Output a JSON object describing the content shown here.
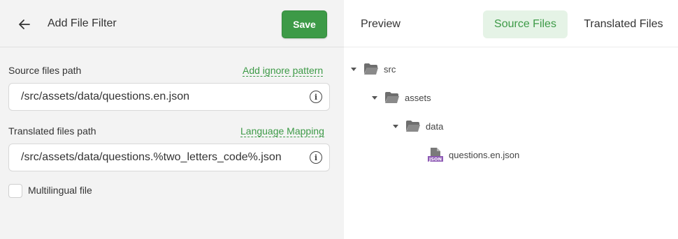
{
  "header": {
    "title": "Add File Filter",
    "save_label": "Save"
  },
  "form": {
    "source": {
      "label": "Source files path",
      "link": "Add ignore pattern",
      "value": "/src/assets/data/questions.en.json"
    },
    "translated": {
      "label": "Translated files path",
      "link": "Language Mapping",
      "value": "/src/assets/data/questions.%two_letters_code%.json"
    },
    "multilingual": {
      "label": "Multilingual file",
      "checked": false
    }
  },
  "preview": {
    "label": "Preview",
    "tabs": [
      {
        "label": "Source Files",
        "active": true
      },
      {
        "label": "Translated Files",
        "active": false
      }
    ],
    "tree": [
      {
        "name": "src",
        "type": "folder",
        "expanded": true
      },
      {
        "name": "assets",
        "type": "folder",
        "expanded": true
      },
      {
        "name": "data",
        "type": "folder",
        "expanded": true
      },
      {
        "name": "questions.en.json",
        "type": "file",
        "badge": "JSON"
      }
    ]
  },
  "colors": {
    "accent": "#3d9a47",
    "active_tab_bg": "#e5f3e6",
    "left_bg": "#f3f3f3",
    "json_badge": "#8e5ab5"
  },
  "icons": {
    "back": "arrow-left-icon",
    "info": "info-icon",
    "folder": "folder-open-icon",
    "file": "json-file-icon",
    "caret": "caret-down-icon"
  }
}
